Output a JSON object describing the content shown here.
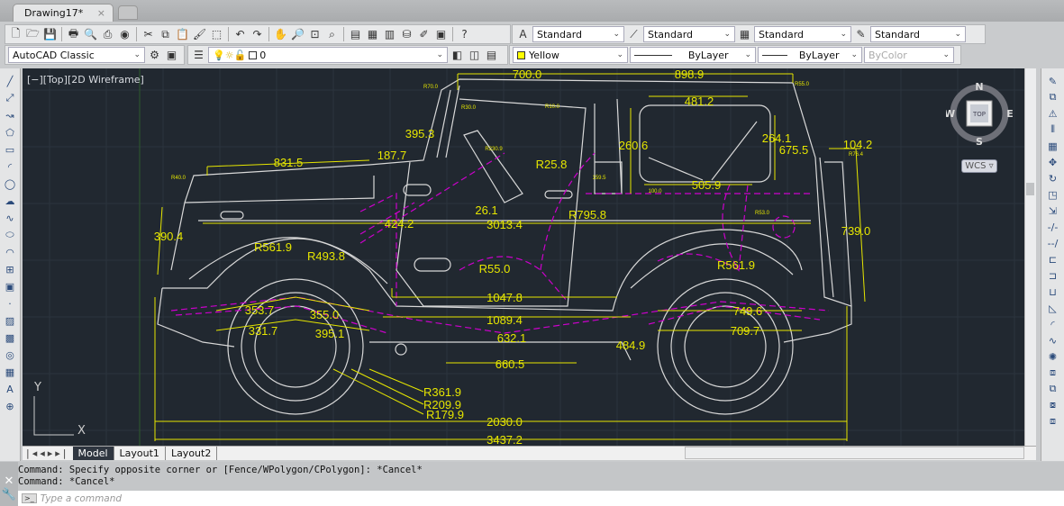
{
  "app": {
    "document_tab": "Drawing17*",
    "tab_close": "×"
  },
  "toolbar1": {
    "icons": [
      "new-icon",
      "open-icon",
      "save-icon",
      "plot-icon",
      "plot-preview-icon",
      "publish-icon",
      "3d-print-icon",
      "cut-icon",
      "copy-icon",
      "paste-icon",
      "match-properties-icon",
      "block-editor-icon",
      "undo-icon",
      "redo-icon",
      "pan-icon",
      "zoom-realtime-icon",
      "zoom-window-icon",
      "zoom-previous-icon",
      "properties-icon",
      "design-center-icon",
      "tool-palettes-icon",
      "sheet-set-icon",
      "markup-icon",
      "quickcalc-icon",
      "help-icon"
    ],
    "text_style": "Standard",
    "dim_style": "Standard",
    "table_style": "Standard",
    "multileader_style": "Standard"
  },
  "toolbar2": {
    "workspace": "AutoCAD Classic",
    "layer": "0",
    "color": "Yellow",
    "color_hex": "#ffff00",
    "linetype": "ByLayer",
    "lineweight": "ByLayer",
    "plotstyle": "ByColor"
  },
  "viewport": {
    "label": "[−][Top][2D Wireframe]",
    "background": "#212830",
    "dimension_color": "#e6e600",
    "geometry_color": "#d8d8d8",
    "hidden_color": "#cc00cc"
  },
  "viewcube": {
    "north": "N",
    "south": "S",
    "east": "E",
    "west": "W",
    "face": "TOP",
    "ucs": "WCS"
  },
  "dimensions": [
    "700.0",
    "898.9",
    "481.2",
    "395.3",
    "187.7",
    "831.5",
    "R25.8",
    "260.6",
    "264.1",
    "675.5",
    "104.2",
    "505.9",
    "26.1",
    "3013.4",
    "R795.8",
    "424.2",
    "390.4",
    "739.0",
    "R561.9",
    "R493.8",
    "R55.0",
    "R561.9",
    "1047.8",
    "353.7",
    "355.0",
    "749.6",
    "1089.4",
    "331.7",
    "395.1",
    "709.7",
    "632.1",
    "484.9",
    "660.5",
    "R361.9",
    "R209.9",
    "R179.9",
    "2030.0",
    "3437.2",
    "R70.0",
    "R30.0",
    "R10.0",
    "R40.0",
    "R55.0",
    "R76.4",
    "R53.0",
    "R230.9",
    "159.5",
    "100.0"
  ],
  "ucs_icon": {
    "x": "X",
    "y": "Y"
  },
  "layout_tabs": [
    "Model",
    "Layout1",
    "Layout2"
  ],
  "command": {
    "history": [
      "Command: Specify opposite corner or [Fence/WPolygon/CPolygon]: *Cancel*",
      "Command: *Cancel*"
    ],
    "placeholder": "Type a command"
  }
}
